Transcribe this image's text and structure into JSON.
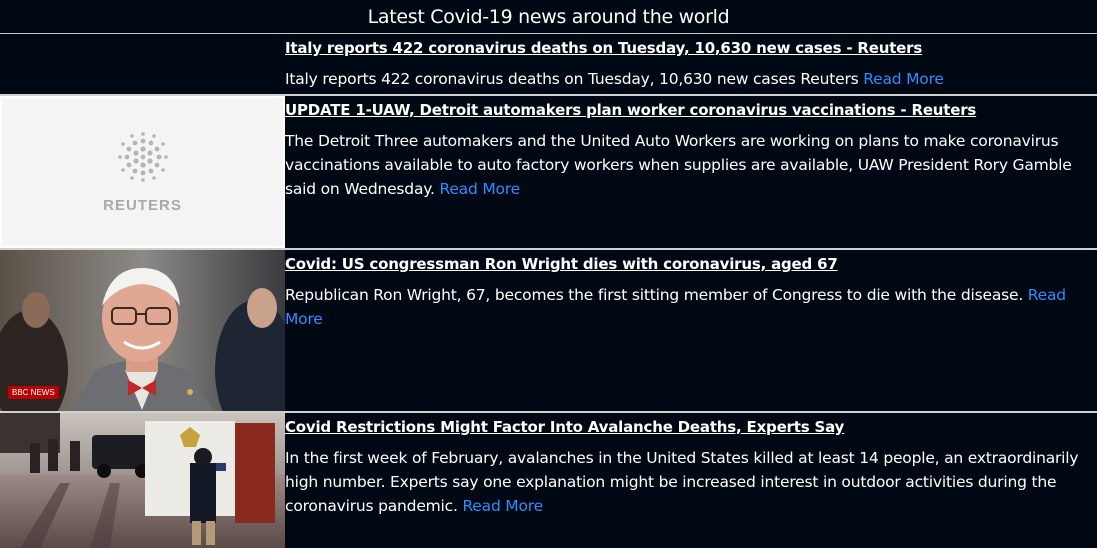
{
  "page": {
    "title": "Latest Covid-19 news around the world"
  },
  "articles": [
    {
      "headline": "Italy reports 422 coronavirus deaths on Tuesday, 10,630 new cases - Reuters",
      "description": "Italy reports 422 coronavirus deaths on Tuesday, 10,630 new cases  Reuters",
      "read_more": "Read More",
      "image": "none"
    },
    {
      "headline": "UPDATE 1-UAW, Detroit automakers plan worker coronavirus vaccinations - Reuters",
      "description": "The Detroit Three automakers and the United Auto Workers are working on plans to make coronavirus vaccinations available to auto factory workers when supplies are available, UAW President Rory Gamble said on Wednesday.",
      "read_more": "Read More",
      "image": "reuters-logo-placeholder",
      "image_text": "REUTERS"
    },
    {
      "headline": "Covid: US congressman Ron Wright dies with coronavirus, aged 67",
      "description": "Republican Ron Wright, 67, becomes the first sitting member of Congress to die with the disease.",
      "read_more": "Read More",
      "image": "photo-congressman-portrait",
      "image_badge": "BBC NEWS"
    },
    {
      "headline": "Covid Restrictions Might Factor Into Avalanche Deaths, Experts Say",
      "description": "In the first week of February, avalanches in the United States killed at least 14 people, an extraordinarily high number. Experts say one explanation might be increased interest in outdoor activities during the coronavirus pandemic.",
      "read_more": "Read More",
      "image": "photo-rescue-scene"
    }
  ],
  "colors": {
    "background": "#000814",
    "text": "#ffffff",
    "link": "#2d8cff",
    "divider": "#d0d0d0"
  }
}
